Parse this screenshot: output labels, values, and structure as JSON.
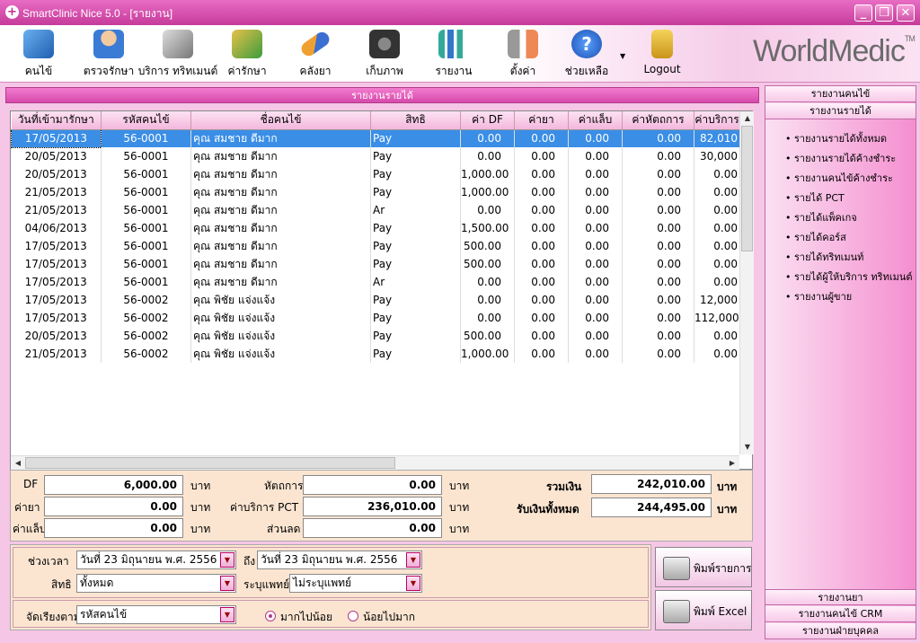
{
  "window": {
    "title": "SmartClinic Nice 5.0 - [รายงาน]",
    "brand": "WorldMedic",
    "brand_mark": "TM",
    "controls": [
      "_",
      "❐",
      "✕"
    ]
  },
  "toolbar": {
    "items": [
      {
        "label": "คนไข้",
        "icon": "patient-icon"
      },
      {
        "label": "ตรวจรักษา",
        "icon": "doctor-icon"
      },
      {
        "label": "บริการ ทริทเมนต์",
        "icon": "masks-icon"
      },
      {
        "label": "ค่ารักษา",
        "icon": "money-icon"
      },
      {
        "label": "คลังยา",
        "icon": "pill-icon"
      },
      {
        "label": "เก็บภาพ",
        "icon": "camera-icon"
      },
      {
        "label": "รายงาน",
        "icon": "chart-icon"
      },
      {
        "label": "ตั้งค่า",
        "icon": "tools-icon"
      },
      {
        "label": "ช่วยเหลือ",
        "icon": "help-icon"
      },
      {
        "label": "Logout",
        "icon": "lock-icon"
      }
    ]
  },
  "report_title": "รายงานรายได้",
  "grid": {
    "columns": [
      "วันที่เข้ามารักษา",
      "รหัสคนไข้",
      "ชื่อคนไข้",
      "สิทธิ",
      "ค่า DF",
      "ค่ายา",
      "ค่าแล็บ",
      "ค่าหัตถการ",
      "ค่าบริการ"
    ],
    "rows": [
      [
        "17/05/2013",
        "56-0001",
        "คุณ สมชาย  ดีมาก",
        "Pay",
        "0.00",
        "0.00",
        "0.00",
        "0.00",
        "82,010"
      ],
      [
        "20/05/2013",
        "56-0001",
        "คุณ สมชาย  ดีมาก",
        "Pay",
        "0.00",
        "0.00",
        "0.00",
        "0.00",
        "30,000"
      ],
      [
        "20/05/2013",
        "56-0001",
        "คุณ สมชาย  ดีมาก",
        "Pay",
        "1,000.00",
        "0.00",
        "0.00",
        "0.00",
        "0.00"
      ],
      [
        "21/05/2013",
        "56-0001",
        "คุณ สมชาย  ดีมาก",
        "Pay",
        "1,000.00",
        "0.00",
        "0.00",
        "0.00",
        "0.00"
      ],
      [
        "21/05/2013",
        "56-0001",
        "คุณ สมชาย  ดีมาก",
        "Ar",
        "0.00",
        "0.00",
        "0.00",
        "0.00",
        "0.00"
      ],
      [
        "04/06/2013",
        "56-0001",
        "คุณ สมชาย  ดีมาก",
        "Pay",
        "1,500.00",
        "0.00",
        "0.00",
        "0.00",
        "0.00"
      ],
      [
        "17/05/2013",
        "56-0001",
        "คุณ สมชาย  ดีมาก",
        "Pay",
        "500.00",
        "0.00",
        "0.00",
        "0.00",
        "0.00"
      ],
      [
        "17/05/2013",
        "56-0001",
        "คุณ สมชาย  ดีมาก",
        "Pay",
        "500.00",
        "0.00",
        "0.00",
        "0.00",
        "0.00"
      ],
      [
        "17/05/2013",
        "56-0001",
        "คุณ สมชาย  ดีมาก",
        "Ar",
        "0.00",
        "0.00",
        "0.00",
        "0.00",
        "0.00"
      ],
      [
        "17/05/2013",
        "56-0002",
        "คุณ พิชัย  แจ่งแจ้ง",
        "Pay",
        "0.00",
        "0.00",
        "0.00",
        "0.00",
        "12,000"
      ],
      [
        "17/05/2013",
        "56-0002",
        "คุณ พิชัย  แจ่งแจ้ง",
        "Pay",
        "0.00",
        "0.00",
        "0.00",
        "0.00",
        "112,000"
      ],
      [
        "20/05/2013",
        "56-0002",
        "คุณ พิชัย  แจ่งแจ้ง",
        "Pay",
        "500.00",
        "0.00",
        "0.00",
        "0.00",
        "0.00"
      ],
      [
        "21/05/2013",
        "56-0002",
        "คุณ พิชัย  แจ่งแจ้ง",
        "Pay",
        "1,000.00",
        "0.00",
        "0.00",
        "0.00",
        "0.00"
      ]
    ],
    "selected_row": 0
  },
  "summary": {
    "df_label": "DF",
    "df": "6,000.00",
    "drug_label": "ค่ายา",
    "drug": "0.00",
    "lab_label": "ค่าแล็บ",
    "lab": "0.00",
    "proc_label": "หัตถการ",
    "proc": "0.00",
    "pct_label": "ค่าบริการ PCT",
    "pct": "236,010.00",
    "discount_label": "ส่วนลด",
    "discount": "0.00",
    "total_label": "รวมเงิน",
    "total": "242,010.00",
    "received_label": "รับเงินทั้งหมด",
    "received": "244,495.00",
    "unit": "บาท"
  },
  "filter": {
    "period_label": "ช่วงเวลา",
    "date_from": "วันที่ 23  มิถุนายน  พ.ศ.  2556",
    "to_label": "ถึง",
    "date_to": "วันที่ 23  มิถุนายน  พ.ศ.  2556",
    "right_label": "สิทธิ",
    "right_value": "ทั้งหมด",
    "doctor_label": "ระบุแพทย์",
    "doctor_value": "ไม่ระบุแพทย์",
    "sort_label": "จัดเรียงตาม",
    "sort_value": "รหัสคนไข้",
    "desc_label": "มากไปน้อย",
    "asc_label": "น้อยไปมาก"
  },
  "buttons": {
    "print_list": "พิมพ์รายการ",
    "print_excel": "พิมพ์ Excel"
  },
  "sidebar": {
    "top_headers": [
      "รายงานคนไข้",
      "รายงานรายได้"
    ],
    "items": [
      "รายงานรายได้ทั้งหมด",
      "รายงานรายได้ค้างชำระ",
      "รายงานคนไข้ค้างชำระ",
      "รายได้ PCT",
      "รายได้แพ็คเกจ",
      "รายได้คอร์ส",
      "รายได้ทริทเมนท์",
      "รายได้ผู้ให้บริการ ทริทเมนต์",
      "รายงานผู้ขาย"
    ],
    "bottom_headers": [
      "รายงานยา",
      "รายงานคนไข้ CRM",
      "รายงานฝ่ายบุคคล"
    ]
  }
}
